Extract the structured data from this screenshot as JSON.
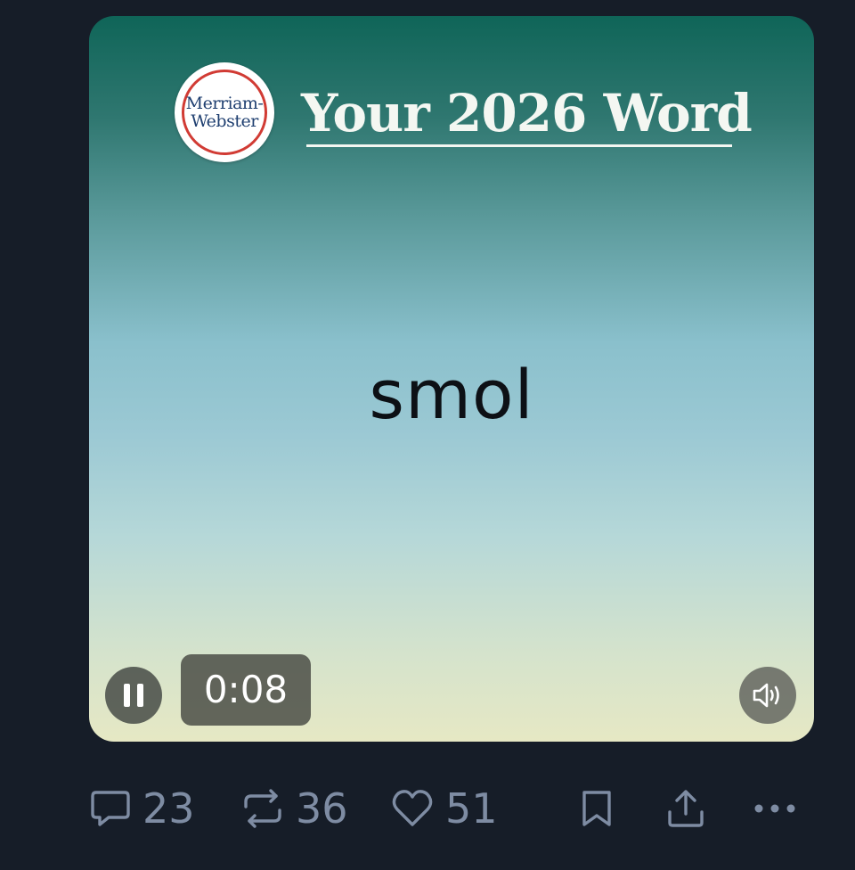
{
  "media": {
    "logo": {
      "line1": "Merriam-",
      "line2": "Webster"
    },
    "headline": "Your 2026 Word",
    "word": "smol",
    "player": {
      "elapsed": "0:08",
      "state": "playing",
      "pause_icon": "pause-icon",
      "volume_icon": "speaker-icon"
    },
    "colors": {
      "gradient_top": "#0f6558",
      "gradient_mid": "#9cc9d4",
      "gradient_bottom": "#e6e8c4",
      "logo_ring": "#d13b34"
    }
  },
  "actions": {
    "reply": {
      "icon": "comment-icon",
      "count": "23"
    },
    "repost": {
      "icon": "repost-icon",
      "count": "36"
    },
    "like": {
      "icon": "heart-icon",
      "count": "51"
    },
    "bookmark": {
      "icon": "bookmark-icon"
    },
    "share": {
      "icon": "share-icon"
    },
    "more": {
      "icon": "more-icon"
    }
  },
  "colors": {
    "background": "#161d28",
    "action_muted": "#7e8ca3"
  }
}
